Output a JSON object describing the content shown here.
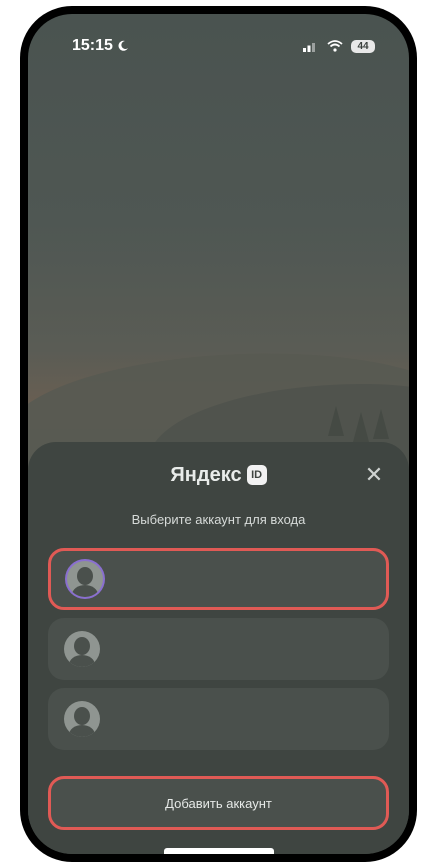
{
  "status_bar": {
    "time": "15:15",
    "battery": "44"
  },
  "sheet": {
    "brand": "Яндекс",
    "brand_badge": "ID",
    "close_icon": "close-icon",
    "subtitle": "Выберите аккаунт для входа",
    "accounts": [
      {
        "avatar": "user-avatar-icon",
        "selected": true
      },
      {
        "avatar": "user-avatar-icon",
        "selected": false
      },
      {
        "avatar": "user-avatar-icon",
        "selected": false
      }
    ],
    "add_account_label": "Добавить аккаунт"
  },
  "colors": {
    "highlight": "#e05a55",
    "sheet_bg": "#3f4541",
    "card_bg": "#4a504c"
  }
}
